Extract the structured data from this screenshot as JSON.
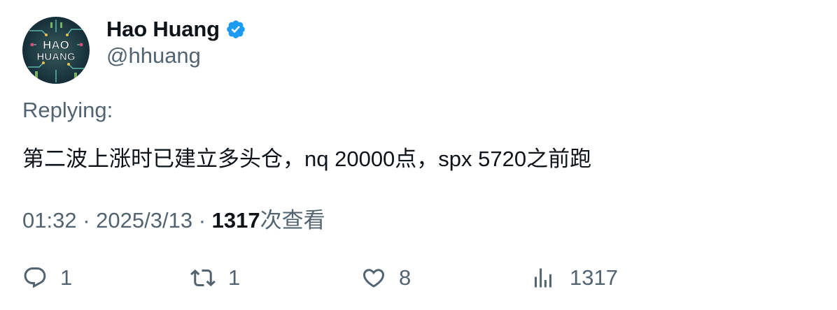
{
  "author": {
    "display_name": "Hao Huang",
    "handle": "@hhuang",
    "avatar_text_line1": "HAO",
    "avatar_text_line2": "HUANG",
    "verified_color": "#1d9bf0"
  },
  "tweet": {
    "replying_label": "Replying:",
    "text": "第二波上涨时已建立多头仓，nq 20000点，spx 5720之前跑",
    "time": "01:32",
    "separator": "·",
    "date": "2025/3/13",
    "views_count": "1317",
    "views_label": "次查看"
  },
  "actions": {
    "reply_count": "1",
    "retweet_count": "1",
    "like_count": "8",
    "views_count": "1317"
  },
  "colors": {
    "text_primary": "#0f1419",
    "text_secondary": "#536471"
  }
}
